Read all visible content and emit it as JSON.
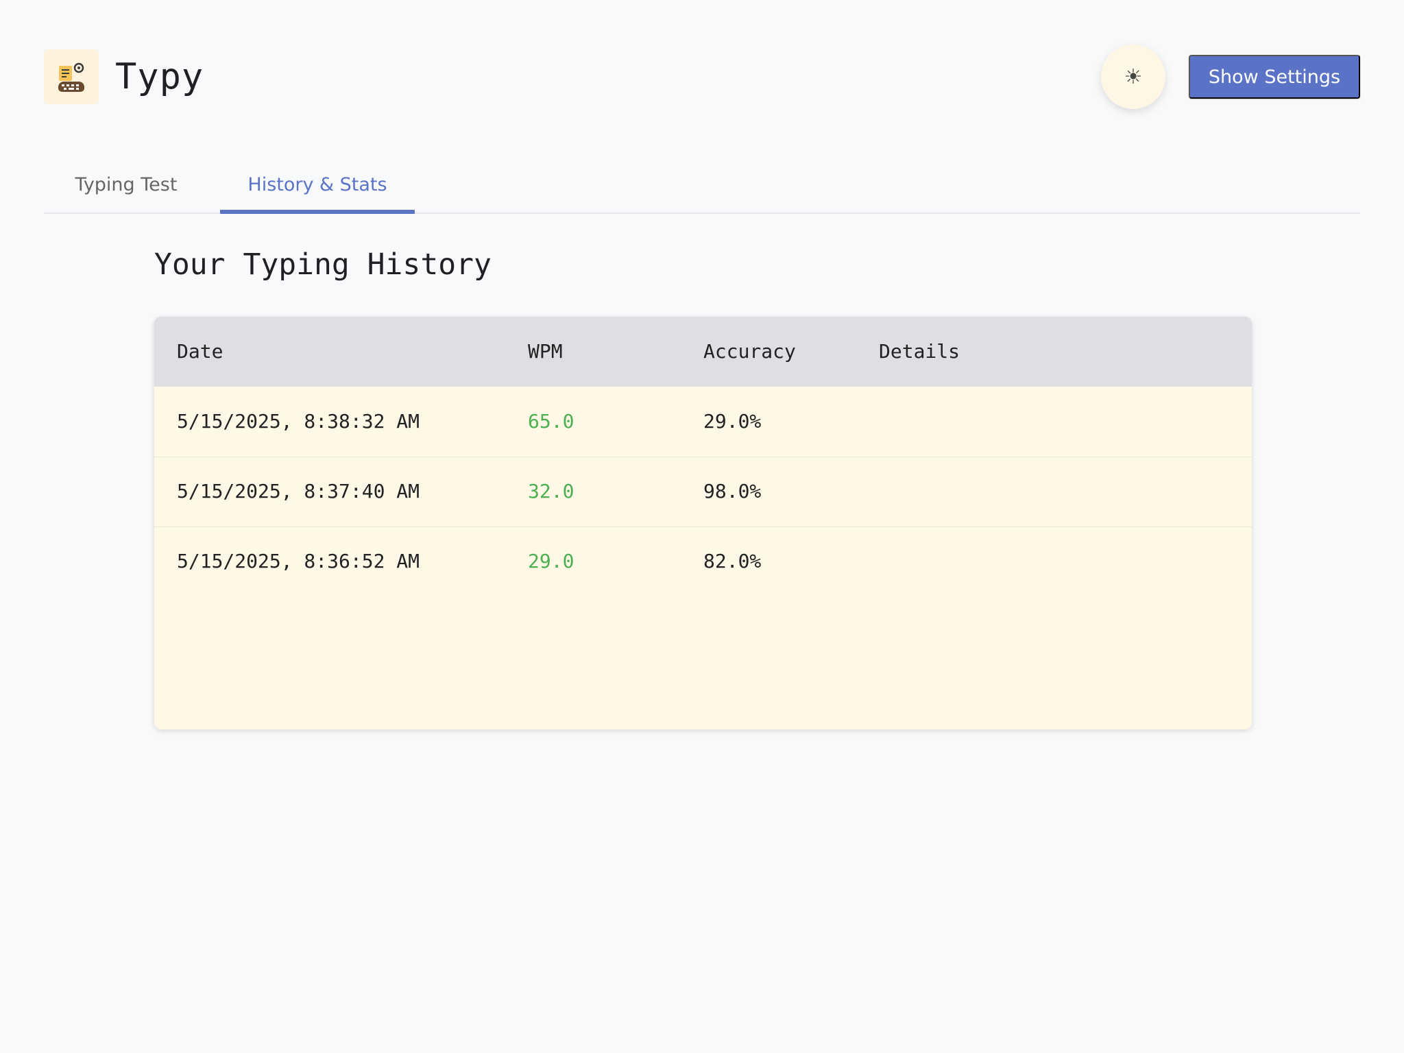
{
  "app": {
    "title": "Typy",
    "logo_icon": "keyboard-gear-icon",
    "theme_icon": "sun-icon",
    "theme_icon_glyph": "☀"
  },
  "header": {
    "settings_label": "Show Settings"
  },
  "tabs": [
    {
      "label": "Typing Test",
      "active": false
    },
    {
      "label": "History & Stats",
      "active": true
    }
  ],
  "history": {
    "title": "Your Typing History",
    "columns": [
      "Date",
      "WPM",
      "Accuracy",
      "Details"
    ],
    "rows": [
      {
        "date": "5/15/2025, 8:38:32 AM",
        "wpm": "65.0",
        "accuracy": "29.0%",
        "details": ""
      },
      {
        "date": "5/15/2025, 8:37:40 AM",
        "wpm": "32.0",
        "accuracy": "98.0%",
        "details": ""
      },
      {
        "date": "5/15/2025, 8:36:52 AM",
        "wpm": "29.0",
        "accuracy": "82.0%",
        "details": ""
      }
    ]
  },
  "colors": {
    "accent": "#5b73c6",
    "wpm_text": "#4caf50",
    "table_background": "#fff8e7",
    "table_header_background": "#dfdfe3",
    "page_background": "#f8f9fb"
  }
}
